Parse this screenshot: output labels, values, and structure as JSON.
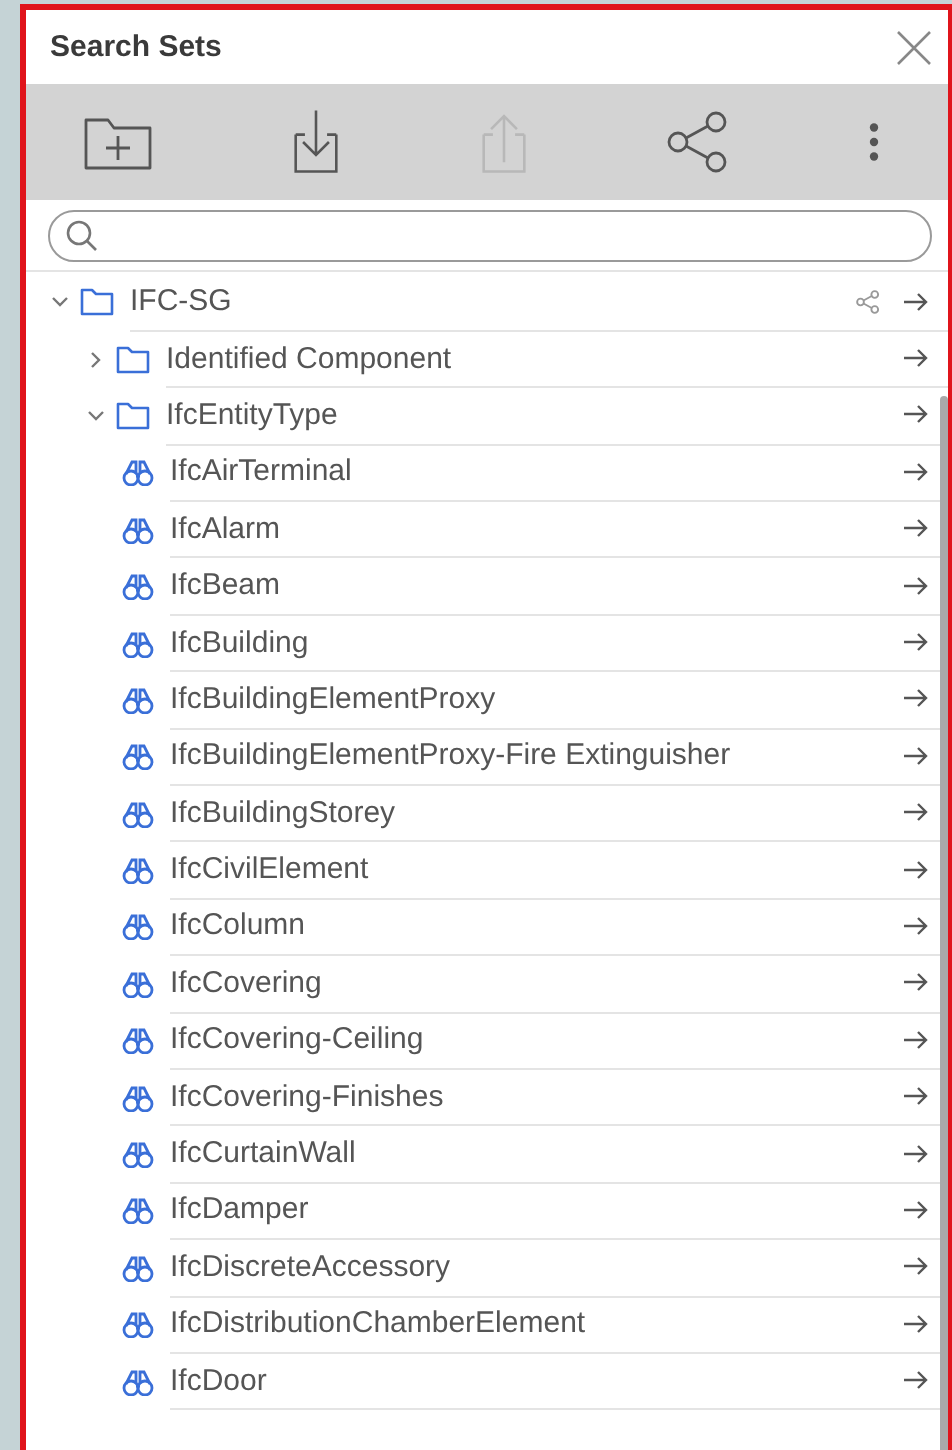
{
  "panel": {
    "title": "Search Sets"
  },
  "toolbar": [
    {
      "kind": "new-folder",
      "disabled": false
    },
    {
      "kind": "import",
      "disabled": false
    },
    {
      "kind": "export",
      "disabled": true
    },
    {
      "kind": "share",
      "disabled": false
    },
    {
      "kind": "more",
      "disabled": false
    }
  ],
  "tree": [
    {
      "label": "IFC-SG",
      "kind": "folder",
      "expanded": true,
      "shared": true,
      "children": [
        {
          "label": "Identified Component",
          "kind": "folder",
          "expanded": false,
          "shared": false
        },
        {
          "label": "IfcEntityType",
          "kind": "folder",
          "expanded": true,
          "shared": false,
          "children": [
            {
              "label": "IfcAirTerminal",
              "kind": "set"
            },
            {
              "label": "IfcAlarm",
              "kind": "set"
            },
            {
              "label": "IfcBeam",
              "kind": "set"
            },
            {
              "label": "IfcBuilding",
              "kind": "set"
            },
            {
              "label": "IfcBuildingElementProxy",
              "kind": "set"
            },
            {
              "label": "IfcBuildingElementProxy-Fire Extinguisher",
              "kind": "set"
            },
            {
              "label": "IfcBuildingStorey",
              "kind": "set"
            },
            {
              "label": "IfcCivilElement",
              "kind": "set"
            },
            {
              "label": "IfcColumn",
              "kind": "set"
            },
            {
              "label": "IfcCovering",
              "kind": "set"
            },
            {
              "label": "IfcCovering-Ceiling",
              "kind": "set"
            },
            {
              "label": "IfcCovering-Finishes",
              "kind": "set"
            },
            {
              "label": "IfcCurtainWall",
              "kind": "set"
            },
            {
              "label": "IfcDamper",
              "kind": "set"
            },
            {
              "label": "IfcDiscreteAccessory",
              "kind": "set"
            },
            {
              "label": "IfcDistributionChamberElement",
              "kind": "set"
            },
            {
              "label": "IfcDoor",
              "kind": "set"
            }
          ]
        }
      ]
    }
  ]
}
